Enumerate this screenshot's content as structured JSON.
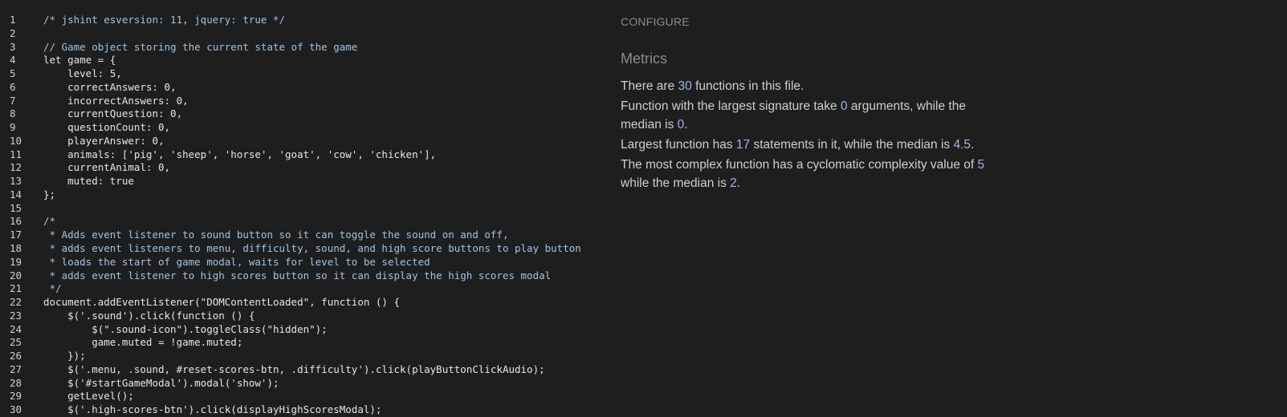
{
  "editor": {
    "lines": [
      {
        "n": "1",
        "text": "/* jshint esversion: 11, jquery: true */",
        "kind": "comment"
      },
      {
        "n": "2",
        "text": "",
        "kind": "code"
      },
      {
        "n": "3",
        "text": "// Game object storing the current state of the game",
        "kind": "comment"
      },
      {
        "n": "4",
        "text": "let game = {",
        "kind": "code"
      },
      {
        "n": "5",
        "text": "    level: 5,",
        "kind": "prop"
      },
      {
        "n": "6",
        "text": "    correctAnswers: 0,",
        "kind": "prop"
      },
      {
        "n": "7",
        "text": "    incorrectAnswers: 0,",
        "kind": "prop"
      },
      {
        "n": "8",
        "text": "    currentQuestion: 0,",
        "kind": "prop"
      },
      {
        "n": "9",
        "text": "    questionCount: 0,",
        "kind": "prop"
      },
      {
        "n": "10",
        "text": "    playerAnswer: 0,",
        "kind": "prop"
      },
      {
        "n": "11",
        "text": "    animals: ['pig', 'sheep', 'horse', 'goat', 'cow', 'chicken'],",
        "kind": "prop"
      },
      {
        "n": "12",
        "text": "    currentAnimal: 0,",
        "kind": "prop"
      },
      {
        "n": "13",
        "text": "    muted: true",
        "kind": "prop"
      },
      {
        "n": "14",
        "text": "};",
        "kind": "code"
      },
      {
        "n": "15",
        "text": "",
        "kind": "code"
      },
      {
        "n": "16",
        "text": "/*",
        "kind": "comment"
      },
      {
        "n": "17",
        "text": " * Adds event listener to sound button so it can toggle the sound on and off,",
        "kind": "comment"
      },
      {
        "n": "18",
        "text": " * adds event listeners to menu, difficulty, sound, and high score buttons to play button",
        "kind": "comment"
      },
      {
        "n": "19",
        "text": " * loads the start of game modal, waits for level to be selected",
        "kind": "comment"
      },
      {
        "n": "20",
        "text": " * adds event listener to high scores button so it can display the high scores modal",
        "kind": "comment"
      },
      {
        "n": "21",
        "text": " */",
        "kind": "comment"
      },
      {
        "n": "22",
        "text": "document.addEventListener(\"DOMContentLoaded\", function () {",
        "kind": "code"
      },
      {
        "n": "23",
        "text": "    $('.sound').click(function () {",
        "kind": "code"
      },
      {
        "n": "24",
        "text": "        $(\".sound-icon\").toggleClass(\"hidden\");",
        "kind": "code"
      },
      {
        "n": "25",
        "text": "        game.muted = !game.muted;",
        "kind": "code"
      },
      {
        "n": "26",
        "text": "    });",
        "kind": "code"
      },
      {
        "n": "27",
        "text": "    $('.menu, .sound, #reset-scores-btn, .difficulty').click(playButtonClickAudio);",
        "kind": "code"
      },
      {
        "n": "28",
        "text": "    $('#startGameModal').modal('show');",
        "kind": "code"
      },
      {
        "n": "29",
        "text": "    getLevel();",
        "kind": "code"
      },
      {
        "n": "30",
        "text": "    $('.high-scores-btn').click(displayHighScoresModal);",
        "kind": "code"
      }
    ]
  },
  "panel": {
    "configure_label": "CONFIGURE",
    "metrics_title": "Metrics",
    "p1": {
      "a": "There are ",
      "n1": "30",
      "b": " functions in this file."
    },
    "p2": {
      "a": "Function with the largest signature take ",
      "n1": "0",
      "b": " arguments, while the median is ",
      "n2": "0",
      "c": "."
    },
    "p3": {
      "a": "Largest function has ",
      "n1": "17",
      "b": " statements in it, while the median is ",
      "n2": "4.5",
      "c": "."
    },
    "p4": {
      "a": "The most complex function has a cyclomatic complexity value of ",
      "n1": "5",
      "b": " while the median is ",
      "n2": "2",
      "c": "."
    }
  }
}
